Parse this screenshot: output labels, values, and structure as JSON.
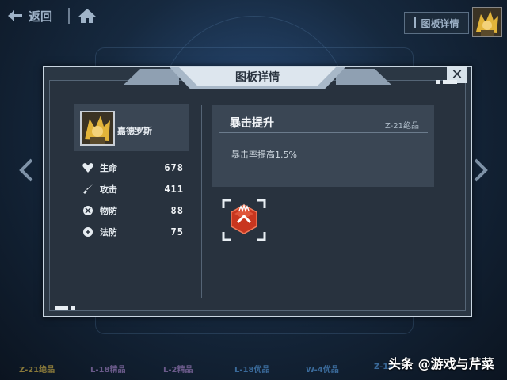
{
  "topbar": {
    "back_label": "返回",
    "tab_label": "图板详情"
  },
  "modal": {
    "title": "图板详情",
    "close_label": "✕"
  },
  "character": {
    "name": "嘉德罗斯"
  },
  "stats": [
    {
      "label": "生命",
      "value": "678",
      "icon": "heart-icon"
    },
    {
      "label": "攻击",
      "value": "411",
      "icon": "sword-icon"
    },
    {
      "label": "物防",
      "value": "88",
      "icon": "shield-icon"
    },
    {
      "label": "法防",
      "value": "75",
      "icon": "magic-shield-icon"
    }
  ],
  "effect": {
    "title": "暴击提升",
    "rank": "Z-21绝品",
    "description": "暴击率提高1.5%"
  },
  "bottom_tabs": [
    {
      "label": "Z-21绝品",
      "color": "#8a7a3a"
    },
    {
      "label": "L-18精品",
      "color": "#6a5a8a"
    },
    {
      "label": "L-2精品",
      "color": "#6a5a8a"
    },
    {
      "label": "L-18优品",
      "color": "#3a6a9a"
    },
    {
      "label": "W-4优品",
      "color": "#3a6a9a"
    },
    {
      "label": "Z-14",
      "color": "#3a6a9a"
    }
  ],
  "watermark": "头条 @游戏与芹菜",
  "colors": {
    "accent_red": "#d8402a",
    "panel_border": "#c9d6e2",
    "panel_bg": "#2b3744"
  }
}
